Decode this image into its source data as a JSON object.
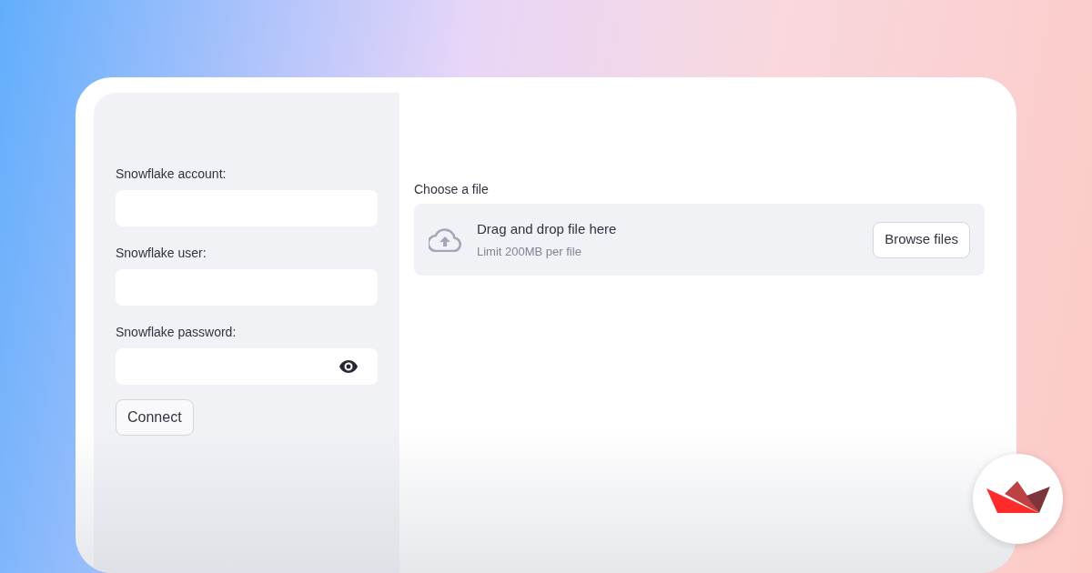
{
  "sidebar": {
    "fields": [
      {
        "label": "Snowflake account:",
        "kind": "text"
      },
      {
        "label": "Snowflake user:",
        "kind": "text"
      },
      {
        "label": "Snowflake password:",
        "kind": "password"
      }
    ],
    "button": "Connect"
  },
  "main": {
    "uploader": {
      "label": "Choose a file",
      "title": "Drag and drop file here",
      "hint": "Limit 200MB per file",
      "button": "Browse files"
    }
  }
}
